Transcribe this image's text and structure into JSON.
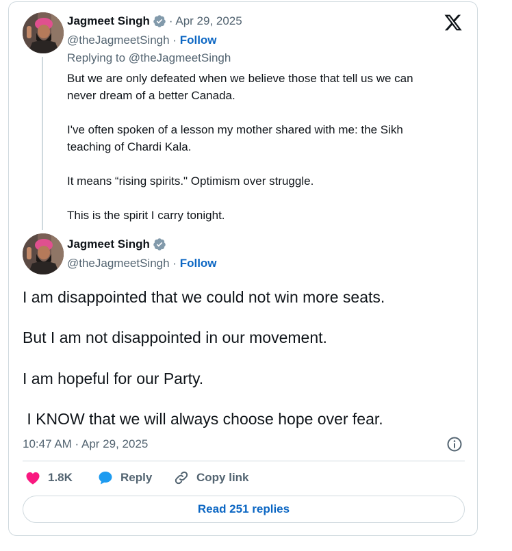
{
  "parent_tweet": {
    "author_name": "Jagmeet Singh",
    "date": "· Apr 29, 2025",
    "handle": "@theJagmeetSingh ·",
    "follow_label": "Follow",
    "replying_to": "Replying to @theJagmeetSingh",
    "paragraphs": [
      "But we are only defeated when we believe those that tell us we can",
      "never dream of a better Canada.",
      "I've often spoken of a lesson my mother shared with me: the Sikh",
      "teaching of Chardi Kala.",
      "It means “rising spirits.\" Optimism over struggle.",
      "This is the spirit I carry tonight."
    ]
  },
  "main_tweet": {
    "author_name": "Jagmeet Singh",
    "handle": "@theJagmeetSingh ·",
    "follow_label": "Follow",
    "lines": [
      "I am disappointed that we could not win more seats.",
      "But I am not disappointed in our movement.",
      "I am hopeful for our Party.",
      " I KNOW that we will always choose hope over fear."
    ],
    "timestamp": "10:47 AM · Apr 29, 2025"
  },
  "actions": {
    "like_count": "1.8K",
    "reply_label": "Reply",
    "copy_link_label": "Copy link"
  },
  "read_replies_label": "Read 251 replies",
  "icons": {
    "logo": "x-logo-icon",
    "verified": "verified-badge-icon",
    "info": "info-icon",
    "like": "heart-icon",
    "reply": "speech-bubble-icon",
    "copy": "link-icon"
  },
  "colors": {
    "like": "#f91880",
    "reply": "#1d9bf0",
    "follow": "#0b66c3",
    "verified": "#829aab"
  }
}
